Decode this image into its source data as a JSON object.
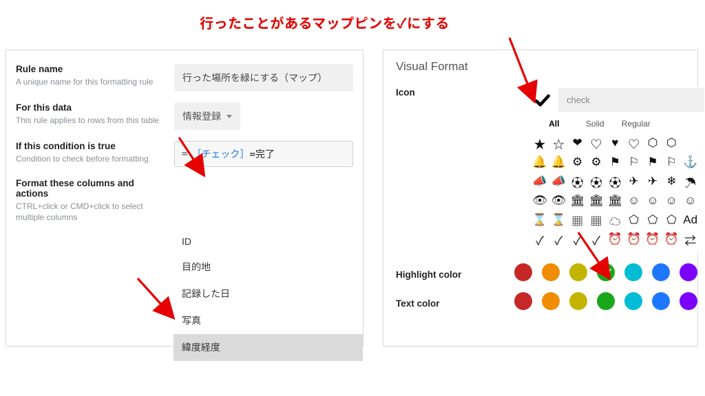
{
  "annotation": "行ったことがあるマップピンを✓にする",
  "left": {
    "rule_name": {
      "label": "Rule name",
      "desc": "A unique name for this formatting rule",
      "value": "行った場所を緑にする（マップ）"
    },
    "for_data": {
      "label": "For this data",
      "desc": "This rule applies to rows from this table",
      "value": "情報登録"
    },
    "condition": {
      "label": "If this condition is true",
      "desc": "Condition to check before formatting",
      "col": "［チェック］",
      "op_after": "=完了"
    },
    "format_cols": {
      "label": "Format these columns and actions",
      "desc": "CTRL+click or CMD+click to select multiple columns"
    },
    "columns": [
      "ID",
      "目的地",
      "記録した日",
      "写真",
      "緯度経度"
    ],
    "selected_col_index": 4
  },
  "right": {
    "title": "Visual Format",
    "icon_label": "Icon",
    "icon_search": "check",
    "icon_cats": [
      "All",
      "Solid",
      "Regular",
      ""
    ],
    "icon_cat_active": 0,
    "icon_glyphs": [
      "★",
      "☆",
      "❤",
      "♡",
      "♥",
      "♡",
      "⬡",
      "⬡",
      "",
      "🔔",
      "🔔",
      "⚙",
      "⚙",
      "⚑",
      "⚐",
      "⚑",
      "⚐",
      "⚓",
      "📣",
      "📣",
      "⚽",
      "⚽",
      "⚽",
      "✈",
      "✈",
      "❄",
      "☂",
      "👁",
      "👁",
      "🏛",
      "🏛",
      "🏛",
      "☺",
      "☺",
      "☺",
      "☺",
      "⌛",
      "⌛",
      "▦",
      "▦",
      "☁",
      "⬠",
      "⬠",
      "⬠",
      "Ad",
      "✓",
      "✓",
      "✓",
      "✓",
      "⏰",
      "⏰",
      "⏰",
      "⏰",
      "⇄"
    ],
    "highlight_label": "Highlight color",
    "text_label": "Text color",
    "swatches_h": [
      "#c62828",
      "#ef8c00",
      "#c3b400",
      "#1aa71a",
      "#00bcd4",
      "#1e78ff",
      "#7c00ff"
    ],
    "swatches_h_selected": 3,
    "swatches_t": [
      "#c62828",
      "#ef8c00",
      "#c3b400",
      "#1aa71a",
      "#00bcd4",
      "#1e78ff",
      "#7c00ff"
    ]
  }
}
